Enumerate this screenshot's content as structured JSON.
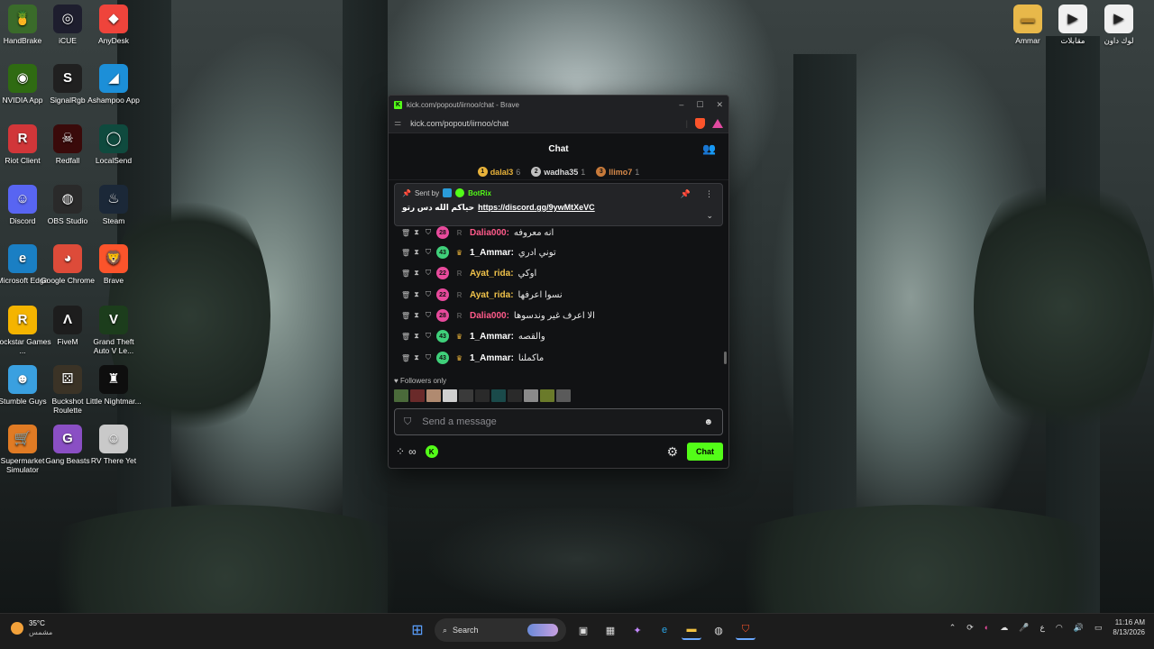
{
  "desktop_left": [
    {
      "label": "HandBrake",
      "icon": "handbrake-icon",
      "color": "#3a6b2a",
      "glyph": "🍍"
    },
    {
      "label": "iCUE",
      "icon": "icue-icon",
      "color": "#1e1e2e",
      "glyph": "◎"
    },
    {
      "label": "AnyDesk",
      "icon": "anydesk-icon",
      "color": "#ef443b",
      "glyph": "◆"
    },
    {
      "label": "NVIDIA App",
      "icon": "nvidia-icon",
      "color": "#2f6b12",
      "glyph": "◉"
    },
    {
      "label": "SignalRgb",
      "icon": "signalrgb-icon",
      "color": "#202020",
      "glyph": "S"
    },
    {
      "label": "Ashampoo App",
      "icon": "ashampoo-icon",
      "color": "#1c8fd8",
      "glyph": "◢"
    },
    {
      "label": "Riot Client",
      "icon": "riot-icon",
      "color": "#d13639",
      "glyph": "R"
    },
    {
      "label": "Redfall",
      "icon": "redfall-icon",
      "color": "#3a0a0a",
      "glyph": "☠"
    },
    {
      "label": "LocalSend",
      "icon": "localsend-icon",
      "color": "#0f4a3e",
      "glyph": "◯"
    },
    {
      "label": "Discord",
      "icon": "discord-icon",
      "color": "#5865f2",
      "glyph": "☺"
    },
    {
      "label": "OBS Studio",
      "icon": "obs-icon",
      "color": "#2a2a2a",
      "glyph": "◍"
    },
    {
      "label": "Steam",
      "icon": "steam-icon",
      "color": "#1b2838",
      "glyph": "♨"
    },
    {
      "label": "Microsoft Edge",
      "icon": "edge-icon",
      "color": "#1a7fc4",
      "glyph": "e"
    },
    {
      "label": "Google Chrome",
      "icon": "chrome-icon",
      "color": "#dd4b39",
      "glyph": "◕"
    },
    {
      "label": "Brave",
      "icon": "brave-icon",
      "color": "#fb542b",
      "glyph": "🦁"
    },
    {
      "label": "Rockstar Games ...",
      "icon": "rockstar-icon",
      "color": "#f4b400",
      "glyph": "R"
    },
    {
      "label": "FiveM",
      "icon": "fivem-icon",
      "color": "#1d1d1d",
      "glyph": "Λ"
    },
    {
      "label": "Grand Theft Auto V Le...",
      "icon": "gta-icon",
      "color": "#1c3d1c",
      "glyph": "V"
    },
    {
      "label": "Stumble Guys",
      "icon": "stumble-icon",
      "color": "#3aa0e0",
      "glyph": "☻"
    },
    {
      "label": "Buckshot Roulette",
      "icon": "buckshot-icon",
      "color": "#3b3326",
      "glyph": "⚄"
    },
    {
      "label": "Little Nightmar...",
      "icon": "nightmares-icon",
      "color": "#0e0e0e",
      "glyph": "♜"
    },
    {
      "label": "Supermarket Simulator",
      "icon": "supermarket-icon",
      "color": "#e07b24",
      "glyph": "🛒"
    },
    {
      "label": "Gang Beasts",
      "icon": "gangbeasts-icon",
      "color": "#8a4fc4",
      "glyph": "G"
    },
    {
      "label": "RV There Yet",
      "icon": "rv-icon",
      "color": "#c9c9c9",
      "glyph": "☺"
    }
  ],
  "desktop_right": [
    {
      "label": "Ammar",
      "icon": "folder-icon",
      "color": "#e8b84a",
      "glyph": "▬"
    },
    {
      "label": "مقابلات",
      "icon": "video-file-icon",
      "color": "#f0f0f0",
      "glyph": "▶"
    },
    {
      "label": "لوك داون",
      "icon": "video-file-icon",
      "color": "#f0f0f0",
      "glyph": "▶"
    }
  ],
  "browser": {
    "title": "kick.com/popout/iirnoo/chat - Brave",
    "url": "kick.com/popout/iirnoo/chat"
  },
  "chat": {
    "header": "Chat",
    "leaders": [
      {
        "rank": "1",
        "name": "dalal3",
        "count": "6",
        "color": "#e8b23a",
        "rank_color": "#e8b23a"
      },
      {
        "rank": "2",
        "name": "wadha35",
        "count": "1",
        "color": "#d8d8d8",
        "rank_color": "#c0c0c0"
      },
      {
        "rank": "3",
        "name": "llimo7",
        "count": "1",
        "color": "#d88a4a",
        "rank_color": "#c87a3a"
      }
    ],
    "pinned": {
      "sent_by": "Sent by",
      "bot": "BotRix",
      "message": "حياكم الله دس رتو",
      "link": "https://discord.gg/9ywMtXeVC"
    },
    "messages": [
      {
        "level": "28",
        "level_color": "#e84a9c",
        "user": "Dalia000:",
        "user_color": "#ff5a8a",
        "text": "انه معروفه",
        "badge": "R",
        "badge_color": "#555"
      },
      {
        "level": "43",
        "level_color": "#3fd07a",
        "user": "1_Ammar:",
        "user_color": "#ffffff",
        "text": "توني ادري",
        "badge": "♛",
        "badge_color": "#e8b23a"
      },
      {
        "level": "22",
        "level_color": "#e84a9c",
        "user": "Ayat_rida:",
        "user_color": "#f0c24a",
        "text": "اوكي",
        "badge": "R",
        "badge_color": "#555"
      },
      {
        "level": "22",
        "level_color": "#e84a9c",
        "user": "Ayat_rida:",
        "user_color": "#f0c24a",
        "text": "نسوا اعرفها",
        "badge": "R",
        "badge_color": "#555"
      },
      {
        "level": "28",
        "level_color": "#e84a9c",
        "user": "Dalia000:",
        "user_color": "#ff5a8a",
        "text": "الا اعرف غير وندسوها",
        "badge": "R",
        "badge_color": "#555"
      },
      {
        "level": "43",
        "level_color": "#3fd07a",
        "user": "1_Ammar:",
        "user_color": "#ffffff",
        "text": "والقصه",
        "badge": "♛",
        "badge_color": "#e8b23a"
      },
      {
        "level": "43",
        "level_color": "#3fd07a",
        "user": "1_Ammar:",
        "user_color": "#ffffff",
        "text": "ماكملنا",
        "badge": "♛",
        "badge_color": "#e8b23a"
      }
    ],
    "followers_only": "Followers only",
    "input_placeholder": "Send a message",
    "chat_button": "Chat",
    "infinity": "∞"
  },
  "taskbar": {
    "temp": "35°C",
    "weather_text": "مشمس",
    "search": "Search",
    "time": "11:16 AM",
    "date": "8/13/2026",
    "lang": "ع"
  },
  "colors": {
    "kick_green": "#53fc18",
    "panel": "#111214"
  }
}
